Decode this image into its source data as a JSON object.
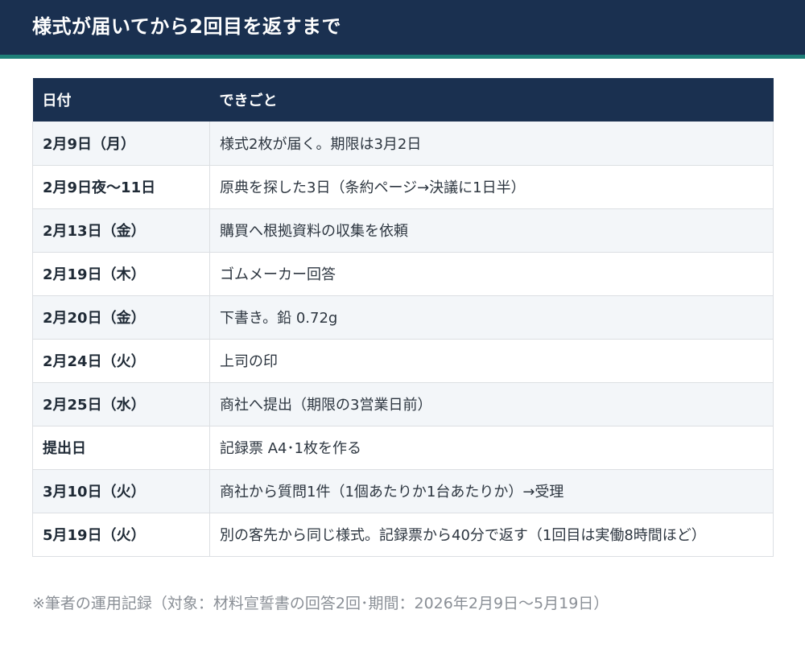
{
  "header": {
    "title": "様式が届いてから2回目を返すまで"
  },
  "table": {
    "columns": {
      "date": "日付",
      "action": "できごと"
    },
    "rows": [
      {
        "date": "2月9日（月）",
        "action": "様式2枚が届く。期限は3月2日"
      },
      {
        "date": "2月9日夜〜11日",
        "action": "原典を探した3日（条約ページ→決議に1日半）"
      },
      {
        "date": "2月13日（金）",
        "action": "購買へ根拠資料の収集を依頼"
      },
      {
        "date": "2月19日（木）",
        "action": "ゴムメーカー回答"
      },
      {
        "date": "2月20日（金）",
        "action": "下書き。鉛 0.72g"
      },
      {
        "date": "2月24日（火）",
        "action": "上司の印"
      },
      {
        "date": "2月25日（水）",
        "action": "商社へ提出（期限の3営業日前）"
      },
      {
        "date": "提出日",
        "action": "記録票 A4･1枚を作る"
      },
      {
        "date": "3月10日（火）",
        "action": "商社から質問1件（1個あたりか1台あたりか）→受理"
      },
      {
        "date": "5月19日（火）",
        "action": "別の客先から同じ様式。記録票から40分で返す（1回目は実働8時間ほど）"
      }
    ]
  },
  "footnote": "※筆者の運用記録（対象：材料宣誓書の回答2回･期間：2026年2月9日〜5月19日）",
  "colors": {
    "header_bg": "#1a3050",
    "accent_line": "#1e7f78",
    "row_alt_bg": "#f3f6f9",
    "footnote_text": "#8a8f96"
  }
}
